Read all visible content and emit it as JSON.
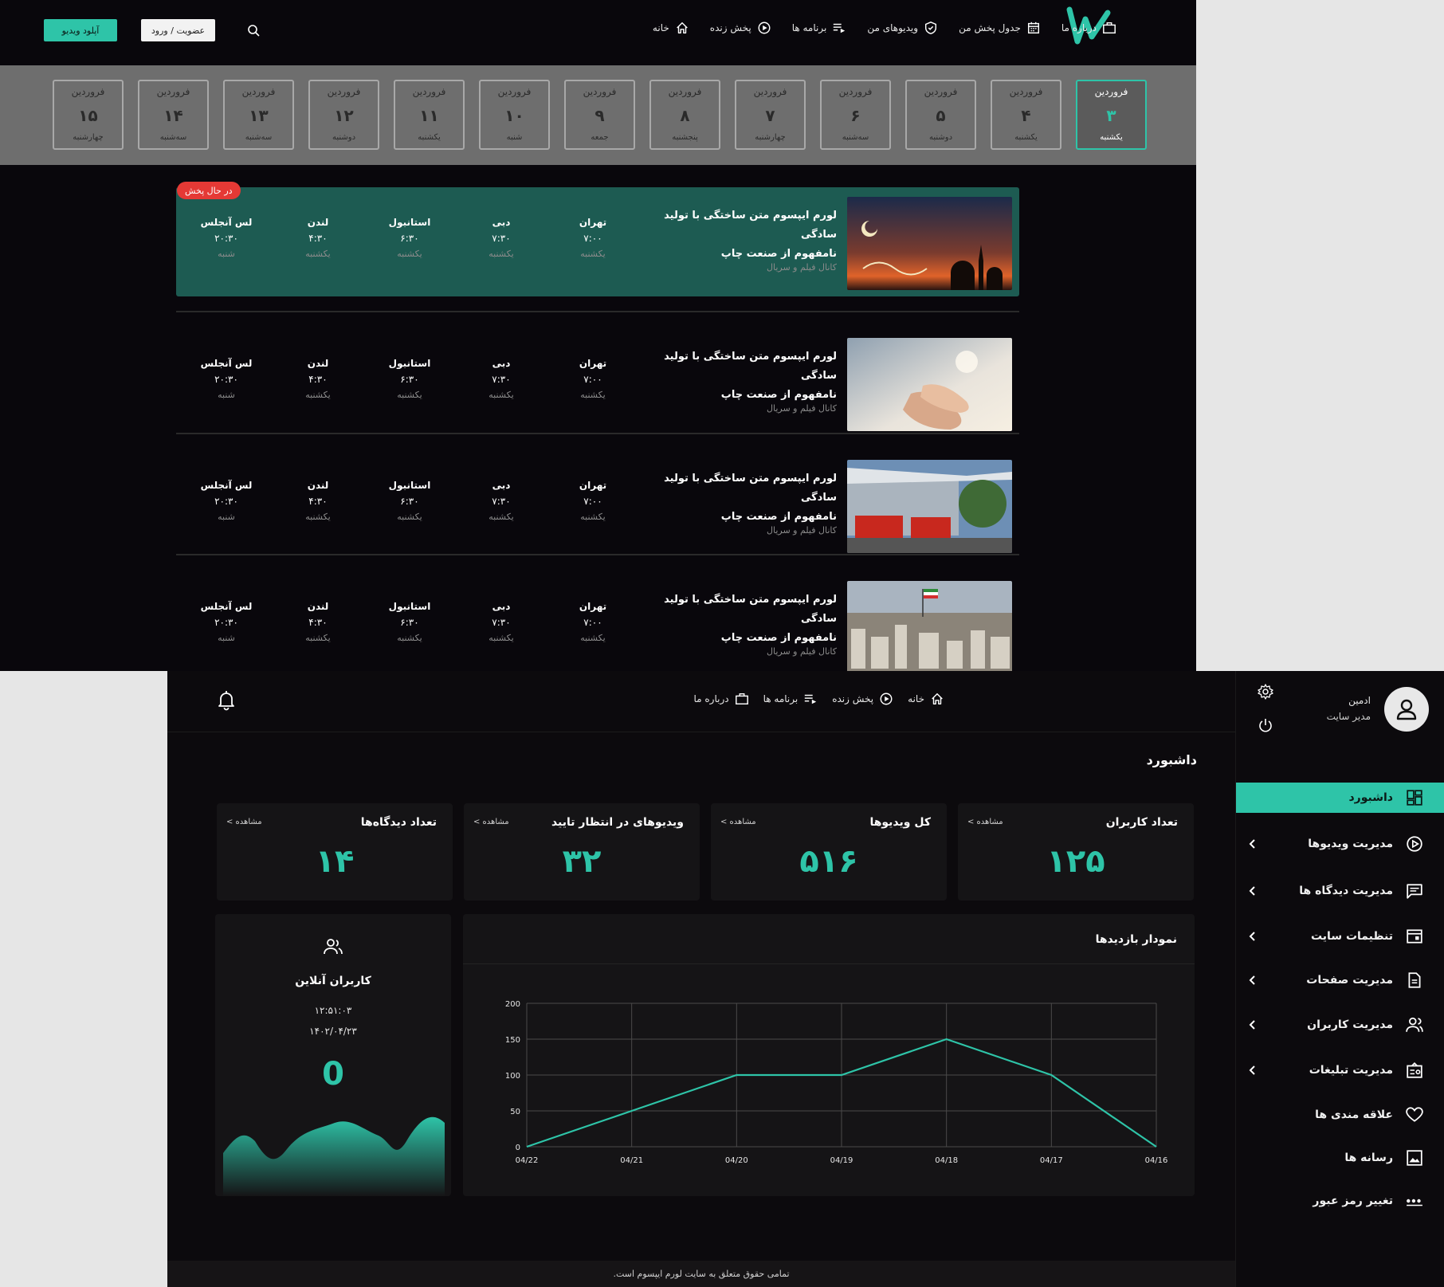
{
  "top_site": {
    "nav": {
      "upload_label": "آپلود ویدیو",
      "login_label": "عضویت / ورود",
      "links": [
        {
          "label": "خانه",
          "icon": "home-icon"
        },
        {
          "label": "پخش زنده",
          "icon": "play-icon"
        },
        {
          "label": "برنامه ها",
          "icon": "playlist-icon"
        },
        {
          "label": "ویدیوهای من",
          "icon": "shield-check-icon"
        },
        {
          "label": "جدول پخش من",
          "icon": "calendar-icon"
        },
        {
          "label": "درباره ما",
          "icon": "briefcase-icon"
        }
      ]
    },
    "days": [
      {
        "month": "فروردین",
        "num": "۳",
        "weekday": "یکشنبه",
        "active": true
      },
      {
        "month": "فروردین",
        "num": "۴",
        "weekday": "یکشنبه"
      },
      {
        "month": "فروردین",
        "num": "۵",
        "weekday": "دوشنبه"
      },
      {
        "month": "فروردین",
        "num": "۶",
        "weekday": "سه‌شنبه"
      },
      {
        "month": "فروردین",
        "num": "۷",
        "weekday": "چهارشنبه"
      },
      {
        "month": "فروردین",
        "num": "۸",
        "weekday": "پنجشنبه"
      },
      {
        "month": "فروردین",
        "num": "۹",
        "weekday": "جمعه"
      },
      {
        "month": "فروردین",
        "num": "۱۰",
        "weekday": "شنبه"
      },
      {
        "month": "فروردین",
        "num": "۱۱",
        "weekday": "یکشنبه"
      },
      {
        "month": "فروردین",
        "num": "۱۲",
        "weekday": "دوشنبه"
      },
      {
        "month": "فروردین",
        "num": "۱۳",
        "weekday": "سه‌شنبه"
      },
      {
        "month": "فروردین",
        "num": "۱۴",
        "weekday": "سه‌شنبه"
      },
      {
        "month": "فروردین",
        "num": "۱۵",
        "weekday": "چهارشنبه"
      }
    ],
    "live_badge": "در حال پخش",
    "programs": [
      {
        "title_line1": "لورم ایپسوم متن ساختگی با تولید سادگی",
        "title_line2": "نامفهوم از صنعت چاپ",
        "channel": "کانال فیلم و سریال",
        "thumb": "ramadan-thumbnail",
        "live": true
      },
      {
        "title_line1": "لورم ایپسوم متن ساختگی با تولید سادگی",
        "title_line2": "نامفهوم از صنعت چاپ",
        "channel": "کانال فیلم و سریال",
        "thumb": "praying-hands-thumbnail"
      },
      {
        "title_line1": "لورم ایپسوم متن ساختگی با تولید سادگی",
        "title_line2": "نامفهوم از صنعت چاپ",
        "channel": "کانال فیلم و سریال",
        "thumb": "fire-station-thumbnail"
      },
      {
        "title_line1": "لورم ایپسوم متن ساختگی با تولید سادگی",
        "title_line2": "نامفهوم از صنعت چاپ",
        "channel": "کانال فیلم و سریال",
        "thumb": "city-skyline-thumbnail"
      }
    ],
    "cities": [
      {
        "city": "تهران",
        "time": "۷:۰۰",
        "day": "یکشنبه"
      },
      {
        "city": "دبی",
        "time": "۷:۳۰",
        "day": "یکشنبه"
      },
      {
        "city": "استانبول",
        "time": "۶:۳۰",
        "day": "یکشنبه"
      },
      {
        "city": "لندن",
        "time": "۴:۳۰",
        "day": "یکشنبه"
      },
      {
        "city": "لس آنجلس",
        "time": "۲۰:۳۰",
        "day": "شنبه"
      }
    ]
  },
  "admin": {
    "user": {
      "name": "ادمین",
      "role": "مدیر سایت"
    },
    "sidebar": [
      {
        "label": "داشبورد",
        "icon": "dashboard-icon",
        "active": true
      },
      {
        "label": "مدیریت ویدیوها",
        "icon": "play-circle-icon",
        "chevron": true
      },
      {
        "label": "مدیریت دیدگاه ها",
        "icon": "comment-icon",
        "chevron": true
      },
      {
        "label": "تنظیمات سایت",
        "icon": "layout-icon",
        "chevron": true
      },
      {
        "label": "مدیریت صفحات",
        "icon": "document-icon",
        "chevron": true
      },
      {
        "label": "مدیریت کاربران",
        "icon": "users-icon",
        "chevron": true
      },
      {
        "label": "مدیریت تبلیغات",
        "icon": "ad-icon",
        "chevron": true
      },
      {
        "label": "علاقه مندی ها",
        "icon": "heart-icon"
      },
      {
        "label": "رسانه ها",
        "icon": "image-icon"
      },
      {
        "label": "تغییر رمز عبور",
        "icon": "password-icon"
      }
    ],
    "nav": [
      {
        "label": "خانه",
        "icon": "home-icon"
      },
      {
        "label": "پخش زنده",
        "icon": "play-icon"
      },
      {
        "label": "برنامه ها",
        "icon": "playlist-icon"
      },
      {
        "label": "درباره ما",
        "icon": "briefcase-icon"
      }
    ],
    "page_title": "داشبورد",
    "stats": [
      {
        "title": "تعداد کاربران",
        "link": "مشاهده >",
        "value": "۱۲۵"
      },
      {
        "title": "کل ویدیوها",
        "link": "مشاهده >",
        "value": "۵۱۶"
      },
      {
        "title": "ویدیوهای در انتظار تایید",
        "link": "مشاهده >",
        "value": "۳۲"
      },
      {
        "title": "تعداد دیدگاه‌ها",
        "link": "مشاهده >",
        "value": "۱۴"
      }
    ],
    "online": {
      "title": "کاربران آنلاین",
      "time": "۱۲:۵۱:۰۳",
      "date": "۱۴۰۲/۰۴/۲۳",
      "count": "0"
    },
    "footer": "تمامی حقوق متعلق به سایت لورم ایپسوم است.",
    "accent": "#2ec4a8"
  },
  "chart_data": {
    "type": "line",
    "title": "نمودار بازدیدها",
    "categories": [
      "04/22",
      "04/21",
      "04/20",
      "04/19",
      "04/18",
      "04/17",
      "04/16"
    ],
    "values": [
      0,
      50,
      100,
      100,
      150,
      100,
      0
    ],
    "ylim": [
      0,
      200
    ],
    "yticks": [
      0,
      50,
      100,
      150,
      200
    ],
    "grid": true,
    "color": "#2ec4a8"
  }
}
